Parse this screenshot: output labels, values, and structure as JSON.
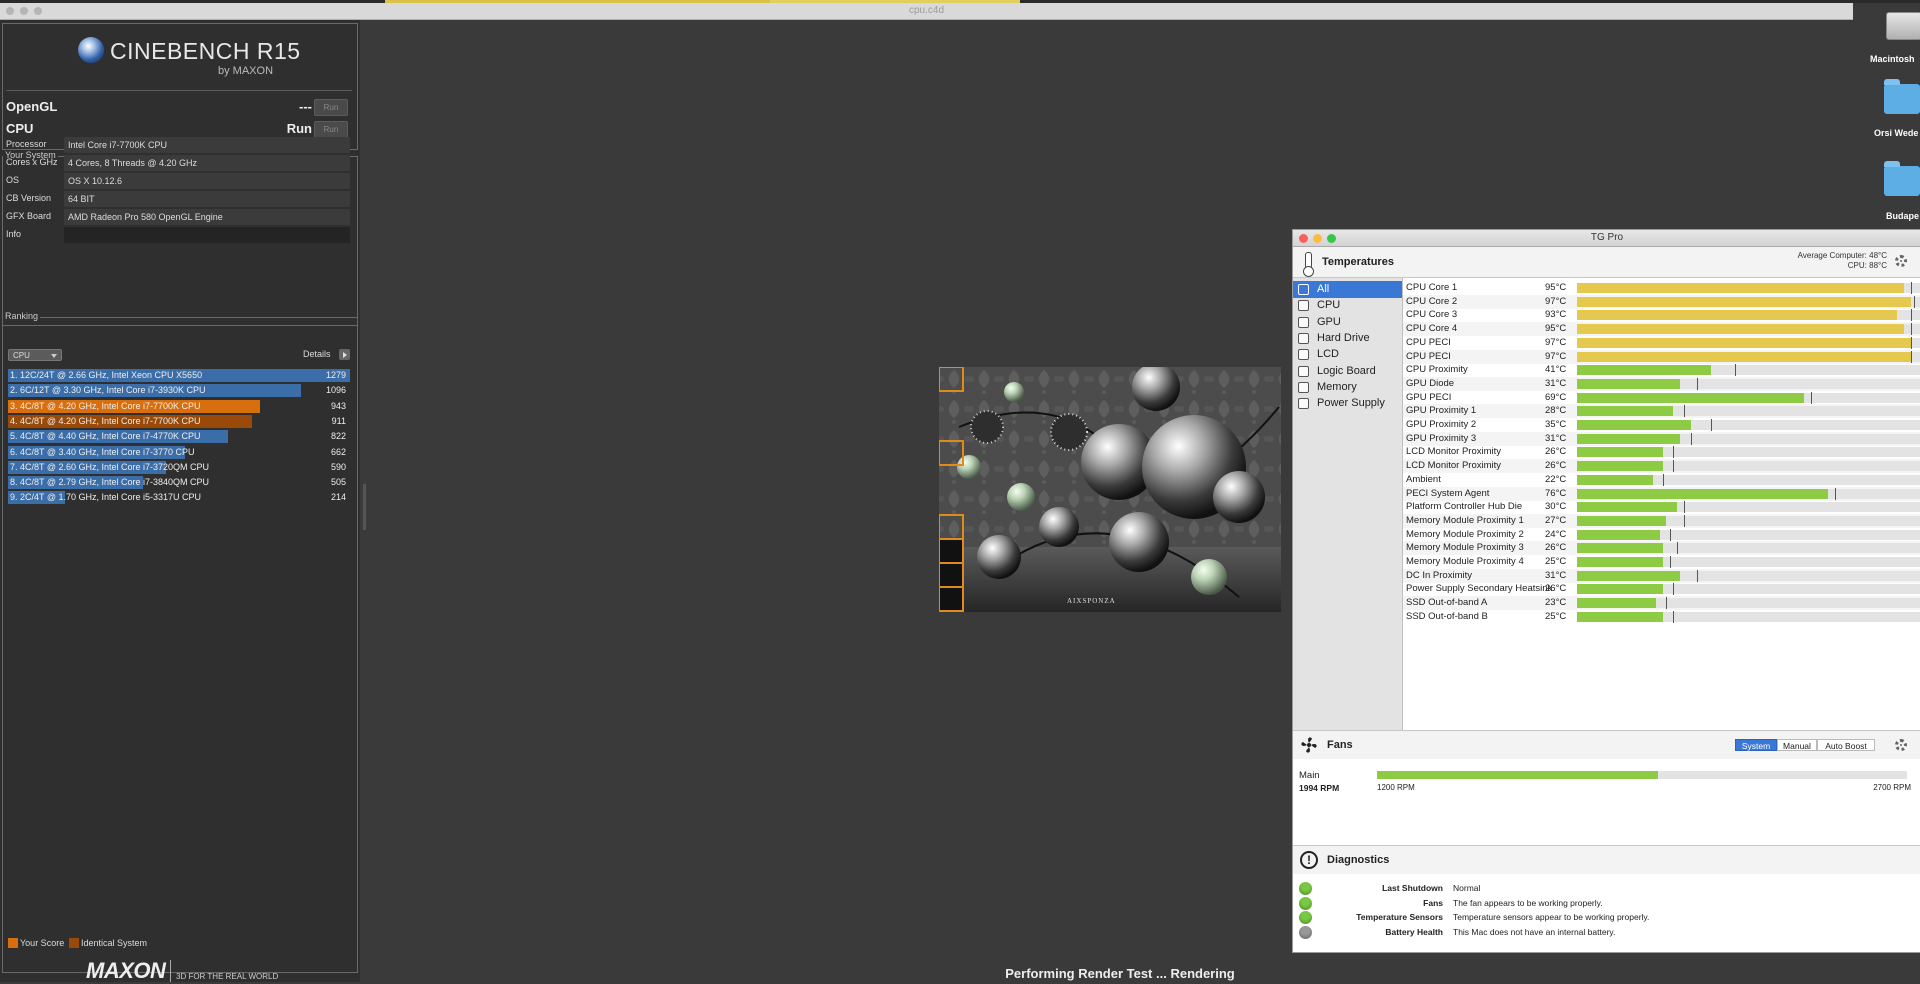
{
  "window": {
    "title": "cpu.c4d"
  },
  "cinebench": {
    "logo": {
      "name": "CINEBENCH R15",
      "by": "by MAXON"
    },
    "tests": [
      {
        "name": "OpenGL",
        "value": "---",
        "button": "Run"
      },
      {
        "name": "CPU",
        "value": "Run",
        "button": "Run"
      }
    ],
    "system": {
      "legend": "Your System",
      "rows": [
        {
          "key": "Processor",
          "value": "Intel Core i7-7700K CPU"
        },
        {
          "key": "Cores x GHz",
          "value": "4 Cores, 8 Threads @ 4.20 GHz"
        },
        {
          "key": "OS",
          "value": "OS X 10.12.6"
        },
        {
          "key": "CB Version",
          "value": "64 BIT"
        },
        {
          "key": "GFX Board",
          "value": "AMD Radeon Pro 580 OpenGL Engine"
        },
        {
          "key": "Info",
          "value": ""
        }
      ]
    },
    "ranking": {
      "legend": "Ranking",
      "selected": "CPU",
      "details": "Details",
      "max": 1279,
      "rows": [
        {
          "label": "1. 12C/24T @ 2.66 GHz, Intel Xeon CPU X5650",
          "score": 1279,
          "kind": "other"
        },
        {
          "label": "2. 6C/12T @ 3.30 GHz,  Intel Core i7-3930K CPU",
          "score": 1096,
          "kind": "other"
        },
        {
          "label": "3. 4C/8T @ 4.20 GHz, Intel Core i7-7700K CPU",
          "score": 943,
          "kind": "yours"
        },
        {
          "label": "4. 4C/8T @ 4.20 GHz, Intel Core i7-7700K CPU",
          "score": 911,
          "kind": "identical"
        },
        {
          "label": "5. 4C/8T @ 4.40 GHz, Intel Core i7-4770K CPU",
          "score": 822,
          "kind": "other"
        },
        {
          "label": "6. 4C/8T @ 3.40 GHz,  Intel Core i7-3770 CPU",
          "score": 662,
          "kind": "other"
        },
        {
          "label": "7. 4C/8T @ 2.60 GHz, Intel Core i7-3720QM CPU",
          "score": 590,
          "kind": "other"
        },
        {
          "label": "8. 4C/8T @ 2.79 GHz, Intel Core i7-3840QM CPU",
          "score": 505,
          "kind": "other"
        },
        {
          "label": "9. 2C/4T @ 1.70 GHz,  Intel Core i5-3317U CPU",
          "score": 214,
          "kind": "other"
        }
      ],
      "legend_items": [
        "Your Score",
        "Identical System"
      ]
    },
    "footer": {
      "brand": "MAXON",
      "tagline": "3D FOR THE REAL WORLD"
    },
    "status": "Performing Render Test ... Rendering",
    "render_watermark": "AIXSPONZA"
  },
  "desktop": {
    "items": [
      {
        "label": "Macintosh",
        "kind": "drive"
      },
      {
        "label": "Orsi Wede",
        "kind": "folder"
      },
      {
        "label": "Budape",
        "kind": "folder"
      }
    ]
  },
  "colors": {
    "yours": "#d86f0e",
    "identical": "#9a4a08",
    "other": "#3b6ea8",
    "cpu_bar": "#e5c94e",
    "other_bar": "#8dcb45",
    "status_ok": "#7ac943",
    "status_na": "#999999",
    "accent": "#3a78d6"
  },
  "tgpro": {
    "title": "TG Pro",
    "temps_header": "Temperatures",
    "average": {
      "computer": "Average Computer:  48°C",
      "cpu": "CPU:  88°C"
    },
    "sidebar": [
      {
        "label": "All",
        "icon": "computer-icon",
        "selected": true
      },
      {
        "label": "CPU",
        "icon": "cpu-icon"
      },
      {
        "label": "GPU",
        "icon": "gpu-icon"
      },
      {
        "label": "Hard Drive",
        "icon": "hard-drive-icon"
      },
      {
        "label": "LCD",
        "icon": "lcd-icon"
      },
      {
        "label": "Logic Board",
        "icon": "logic-board-icon"
      },
      {
        "label": "Memory",
        "icon": "memory-icon"
      },
      {
        "label": "Power Supply",
        "icon": "power-icon"
      }
    ],
    "sensors": [
      {
        "name": "CPU Core 1",
        "temp": "95°C",
        "level": 95,
        "max": 97,
        "kind": "cpu"
      },
      {
        "name": "CPU Core 2",
        "temp": "97°C",
        "level": 97,
        "max": 98,
        "kind": "cpu"
      },
      {
        "name": "CPU Core 3",
        "temp": "93°C",
        "level": 93,
        "max": 97,
        "kind": "cpu"
      },
      {
        "name": "CPU Core 4",
        "temp": "95°C",
        "level": 95,
        "max": 97,
        "kind": "cpu"
      },
      {
        "name": "CPU PECI",
        "temp": "97°C",
        "level": 97,
        "max": 97,
        "kind": "cpu"
      },
      {
        "name": "CPU PECI",
        "temp": "97°C",
        "level": 97,
        "max": 97,
        "kind": "cpu"
      },
      {
        "name": "CPU Proximity",
        "temp": "41°C",
        "level": 39,
        "max": 46,
        "kind": "other"
      },
      {
        "name": "GPU Diode",
        "temp": "31°C",
        "level": 30,
        "max": 35,
        "kind": "other"
      },
      {
        "name": "GPU PECI",
        "temp": "69°C",
        "level": 66,
        "max": 68,
        "kind": "other"
      },
      {
        "name": "GPU Proximity 1",
        "temp": "28°C",
        "level": 28,
        "max": 31,
        "kind": "other"
      },
      {
        "name": "GPU Proximity 2",
        "temp": "35°C",
        "level": 33,
        "max": 39,
        "kind": "other"
      },
      {
        "name": "GPU Proximity 3",
        "temp": "31°C",
        "level": 30,
        "max": 33,
        "kind": "other"
      },
      {
        "name": "LCD Monitor Proximity",
        "temp": "26°C",
        "level": 25,
        "max": 28,
        "kind": "other"
      },
      {
        "name": "LCD Monitor Proximity",
        "temp": "26°C",
        "level": 25,
        "max": 28,
        "kind": "other"
      },
      {
        "name": "Ambient",
        "temp": "22°C",
        "level": 22,
        "max": 25,
        "kind": "other"
      },
      {
        "name": "PECI System Agent",
        "temp": "76°C",
        "level": 73,
        "max": 75,
        "kind": "other"
      },
      {
        "name": "Platform Controller Hub Die",
        "temp": "30°C",
        "level": 29,
        "max": 31,
        "kind": "other"
      },
      {
        "name": "Memory Module Proximity 1",
        "temp": "27°C",
        "level": 26,
        "max": 31,
        "kind": "other"
      },
      {
        "name": "Memory Module Proximity 2",
        "temp": "24°C",
        "level": 24,
        "max": 27,
        "kind": "other"
      },
      {
        "name": "Memory Module Proximity 3",
        "temp": "26°C",
        "level": 25,
        "max": 29,
        "kind": "other"
      },
      {
        "name": "Memory Module Proximity 4",
        "temp": "25°C",
        "level": 25,
        "max": 27,
        "kind": "other"
      },
      {
        "name": "DC In Proximity",
        "temp": "31°C",
        "level": 30,
        "max": 35,
        "kind": "other"
      },
      {
        "name": "Power Supply Secondary Heatsink",
        "temp": "26°C",
        "level": 25,
        "max": 28,
        "kind": "other"
      },
      {
        "name": "SSD Out-of-band A",
        "temp": "23°C",
        "level": 23,
        "max": 26,
        "kind": "other"
      },
      {
        "name": "SSD Out-of-band B",
        "temp": "25°C",
        "level": 25,
        "max": 28,
        "kind": "other"
      }
    ],
    "fans": {
      "header": "Fans",
      "modes": [
        "System",
        "Manual",
        "Auto Boost"
      ],
      "active_mode": "System",
      "fan": {
        "name": "Main",
        "rpm": "1994 RPM",
        "min": "1200 RPM",
        "max": "2700 RPM",
        "level": 0.53
      }
    },
    "diagnostics": {
      "header": "Diagnostics",
      "items": [
        {
          "key": "Last Shutdown",
          "value": "Normal",
          "status": "ok"
        },
        {
          "key": "Fans",
          "value": "The fan appears to be working properly.",
          "status": "ok"
        },
        {
          "key": "Temperature Sensors",
          "value": "Temperature sensors appear to be working properly.",
          "status": "ok"
        },
        {
          "key": "Battery Health",
          "value": "This Mac does not have an internal battery.",
          "status": "na"
        }
      ]
    }
  }
}
